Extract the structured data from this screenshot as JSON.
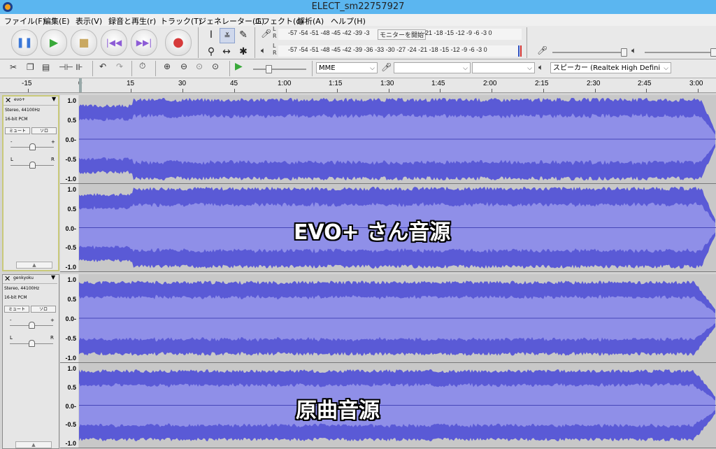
{
  "window": {
    "title": "ELECT_sm22757927"
  },
  "menu": [
    "ファイル(F)",
    "編集(E)",
    "表示(V)",
    "録音と再生(r)",
    "トラック(T)",
    "ジェネレーター(G)",
    "エフェクト(c)",
    "解析(A)",
    "ヘルプ(H)"
  ],
  "meters": {
    "record_scale": "-57 -54 -51 -48 -45 -42 -39 -3",
    "monitor_label": "モニターを開始",
    "record_scale_tail": "-21 -18 -15 -12 -9 -6 -3 0",
    "playback_scale": "-57 -54 -51 -48 -45 -42 -39 -36 -33 -30 -27 -24 -21 -18 -15 -12 -9 -6 -3 0",
    "channel_l": "L",
    "channel_r": "R"
  },
  "device": {
    "host": "MME",
    "input": "",
    "channels": "",
    "output": "スピーカー (Realtek High Defini"
  },
  "ruler": {
    "labels": [
      "-15",
      "0",
      "15",
      "30",
      "45",
      "1:00",
      "1:15",
      "1:30",
      "1:45",
      "2:00",
      "2:15",
      "2:30",
      "2:45",
      "3:00"
    ]
  },
  "tracks": [
    {
      "name": "evo+",
      "format": "Stereo, 44100Hz",
      "bits": "16-bit PCM",
      "mute": "ミュート",
      "solo": "ソロ",
      "gain_minus": "-",
      "gain_plus": "+",
      "pan_l": "L",
      "pan_r": "R",
      "overlay_text": "EVO+ さん音源"
    },
    {
      "name": "genkyoku",
      "format": "Stereo, 44100Hz",
      "bits": "16-bit PCM",
      "mute": "ミュート",
      "solo": "ソロ",
      "gain_minus": "-",
      "gain_plus": "+",
      "pan_l": "L",
      "pan_r": "R",
      "overlay_text": "原曲音源"
    }
  ],
  "scale_values": [
    "1.0",
    "0.5",
    "0.0-",
    "-0.5",
    "-1.0"
  ],
  "colors": {
    "waveform": "#5a5ad6",
    "waveform_rms": "#8f8fe8",
    "titlebar": "#5bb6f0",
    "background": "#c8c8c8"
  }
}
